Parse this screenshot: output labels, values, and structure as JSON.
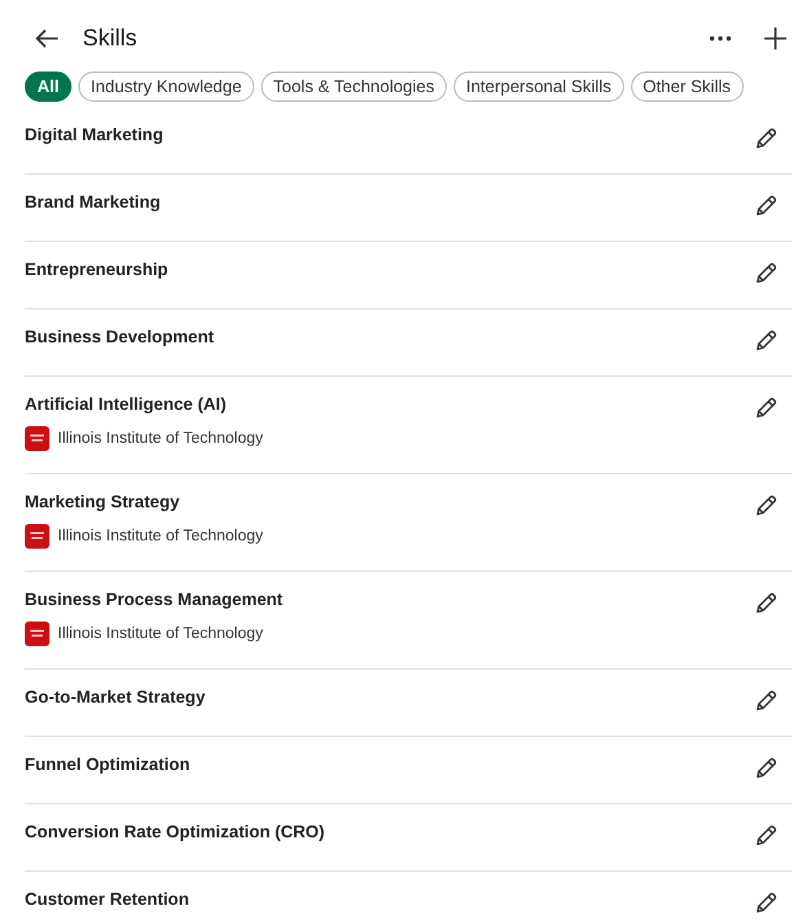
{
  "header": {
    "title": "Skills"
  },
  "filters": [
    {
      "label": "All",
      "selected": true
    },
    {
      "label": "Industry Knowledge",
      "selected": false
    },
    {
      "label": "Tools & Technologies",
      "selected": false
    },
    {
      "label": "Interpersonal Skills",
      "selected": false
    },
    {
      "label": "Other Skills",
      "selected": false
    }
  ],
  "skills": [
    {
      "name": "Digital Marketing"
    },
    {
      "name": "Brand Marketing"
    },
    {
      "name": "Entrepreneurship"
    },
    {
      "name": "Business Development"
    },
    {
      "name": "Artificial Intelligence (AI)",
      "school": "Illinois Institute of Technology"
    },
    {
      "name": "Marketing Strategy",
      "school": "Illinois Institute of Technology"
    },
    {
      "name": "Business Process Management",
      "school": "Illinois Institute of Technology"
    },
    {
      "name": "Go-to-Market Strategy"
    },
    {
      "name": "Funnel Optimization"
    },
    {
      "name": "Conversion Rate Optimization (CRO)"
    },
    {
      "name": "Customer Retention"
    }
  ]
}
